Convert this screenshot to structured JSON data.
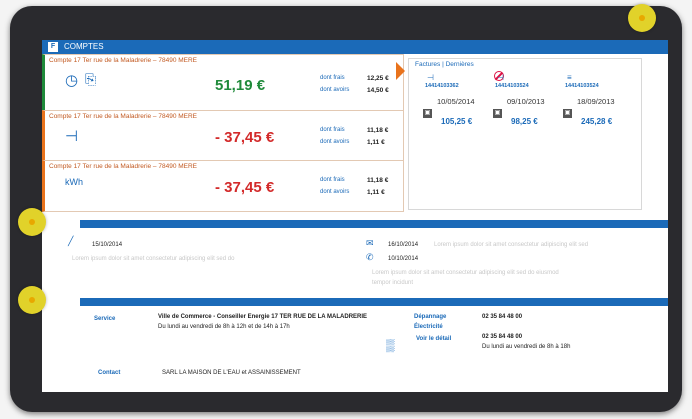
{
  "header": {
    "title": "COMPTES",
    "logo": "F"
  },
  "accounts": [
    {
      "account_label": "Compte 17 Ter rue de la Maladrerie – 78490 MERE",
      "amount": "51,19 €",
      "fees_label": "dont frais",
      "fees_value": "12,25 €",
      "credit_label": "dont avoirs",
      "credit_value": "14,50 €",
      "icon": "clock-icon",
      "amount_color": "#1f8a3a"
    },
    {
      "account_label": "Compte 17 Ter rue de la Maladrerie – 78490 MERE",
      "amount": "- 37,45 €",
      "fees_label": "dont frais",
      "fees_value": "11,18 €",
      "credit_label": "dont avoirs",
      "credit_value": "1,11 €",
      "icon": "plug-icon",
      "amount_color": "#d32a2a"
    },
    {
      "account_label": "Compte 17 Ter rue de la Maladrerie – 78490 MERE",
      "amount": "- 37,45 €",
      "fees_label": "dont frais",
      "fees_value": "11,18 €",
      "credit_label": "dont avoirs",
      "credit_value": "1,11 €",
      "icon": "kwh-icon",
      "amount_color": "#d32a2a"
    }
  ],
  "recent": {
    "title": "Factures | Dernières",
    "items": [
      {
        "account": "14414103362",
        "date": "10/05/2014",
        "amount": "105,25 €"
      },
      {
        "account": "14414103524",
        "date": "09/10/2013",
        "amount": "98,25 €"
      },
      {
        "account": "14414103524",
        "date": "18/09/2013",
        "amount": "245,28 €"
      }
    ]
  },
  "messages": {
    "left_date": "15/10/2014",
    "left_text": "Lorem ipsum dolor sit amet consectetur adipiscing elit sed do",
    "row1_date": "16/10/2014",
    "row1_text": "Lorem ipsum dolor sit amet consectetur adipiscing elit sed",
    "row2_date": "10/10/2014",
    "row2_text": "Lorem ipsum dolor sit amet consectetur adipiscing elit sed do eiusmod",
    "row2_text2": "tempor incidunt"
  },
  "contacts": {
    "c1_label": "Service",
    "c1_text": "Ville de Commerce - Conseiller Energie 17 TER RUE DE LA MALADRERIE",
    "c1_sub": "Du lundi au vendredi de 8h à 12h et de 14h à 17h",
    "c2_label": "Dépannage",
    "c2_sub": "Électricité",
    "c2_link": "Voir le détail",
    "phone1": "02 35 84 48 00",
    "phone2": "02 35 84 48 00",
    "phone_sub": "Du lundi au vendredi de 8h à 18h",
    "c3_label": "Contact",
    "c3_text": "SARL LA MAISON DE L'EAU et ASSAINISSEMENT"
  },
  "colors": {
    "accent": "#1b6ab8",
    "orange": "#e9731c",
    "positive": "#1f8a3a",
    "negative": "#d32a2a",
    "marker": "#e1d22a"
  }
}
